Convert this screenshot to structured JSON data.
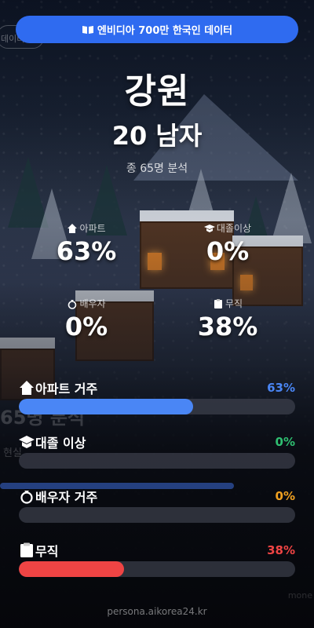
{
  "header": {
    "badge_label": "엔비디아 700만 한국인 데이터",
    "badge_icon": "book-icon",
    "ghost_tag": "데이터"
  },
  "profile": {
    "region": "강원",
    "demographic": "20 남자",
    "total": "종 65명 분석"
  },
  "stats": [
    {
      "icon": "house-icon",
      "label": "아파트",
      "value": "63%"
    },
    {
      "icon": "graduation-cap-icon",
      "label": "대졸이상",
      "value": "0%"
    },
    {
      "icon": "ring-icon",
      "label": "배우자",
      "value": "0%"
    },
    {
      "icon": "clipboard-icon",
      "label": "무직",
      "value": "38%"
    }
  ],
  "bars": [
    {
      "icon": "house-icon",
      "label": "아파트 거주",
      "value": "63%",
      "fraction": 0.63,
      "color": "#4a86f5"
    },
    {
      "icon": "graduation-cap-icon",
      "label": "대졸 이상",
      "value": "0%",
      "fraction": 0.0,
      "color": "#2fbf71"
    },
    {
      "icon": "ring-icon",
      "label": "배우자 거주",
      "value": "0%",
      "fraction": 0.0,
      "color": "#f0a020"
    },
    {
      "icon": "clipboard-icon",
      "label": "무직",
      "value": "38%",
      "fraction": 0.38,
      "color": "#ef4444"
    }
  ],
  "ghost": {
    "big": "65명 분석",
    "small": "현실",
    "right": "mone"
  },
  "footer": {
    "domain": "persona.aikorea24.kr"
  }
}
